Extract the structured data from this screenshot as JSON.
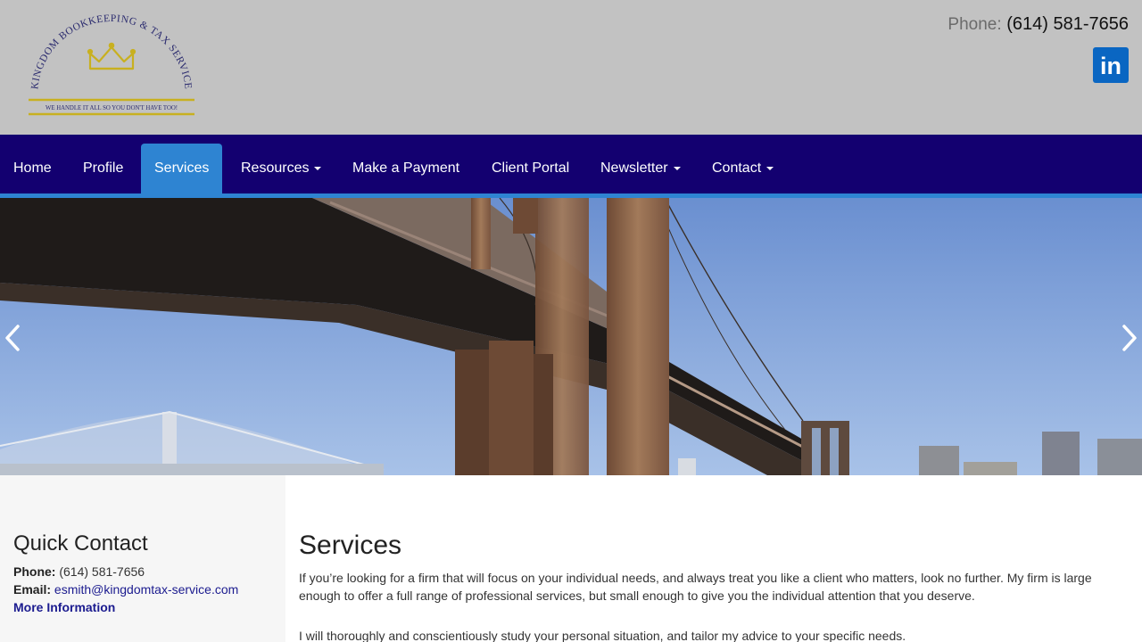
{
  "header": {
    "logo": {
      "arc_text": "KINGDOM BOOKKEEPING & TAX SERVICE",
      "tagline": "WE HANDLE IT ALL SO YOU DON'T HAVE TOO!"
    },
    "phone_label": "Phone:",
    "phone_number": "(614) 581-7656",
    "linkedin_text": "in"
  },
  "nav": {
    "items": [
      {
        "label": "Home"
      },
      {
        "label": "Profile"
      },
      {
        "label": "Services"
      },
      {
        "label": "Resources"
      },
      {
        "label": "Make a Payment"
      },
      {
        "label": "Client Portal"
      },
      {
        "label": "Newsletter"
      },
      {
        "label": "Contact"
      }
    ],
    "active_index": 2
  },
  "sidebar": {
    "title": "Quick Contact",
    "phone_label": "Phone:",
    "phone_value": "(614) 581-7656",
    "email_label": "Email:",
    "email_value": "esmith@kingdomtax-service.com",
    "more_info": "More Information"
  },
  "main": {
    "title": "Services",
    "paragraphs": [
      "If you’re looking for a firm that will focus on your individual needs, and always treat you like a client who matters, look no further. My firm is large enough to offer a full range of professional services, but small enough to give you the individual attention that you deserve.",
      "I will thoroughly and conscientiously study your personal situation, and tailor my advice to your specific needs."
    ]
  },
  "colors": {
    "header_bg": "#c2c2c2",
    "nav_bg": "#130070",
    "nav_active": "#2e84d2",
    "link": "#1b1b8f",
    "linkedin": "#0a66c2"
  },
  "icons": [
    "crown-icon",
    "linkedin-icon",
    "chevron-left-icon",
    "chevron-right-icon",
    "caret-down-icon"
  ]
}
